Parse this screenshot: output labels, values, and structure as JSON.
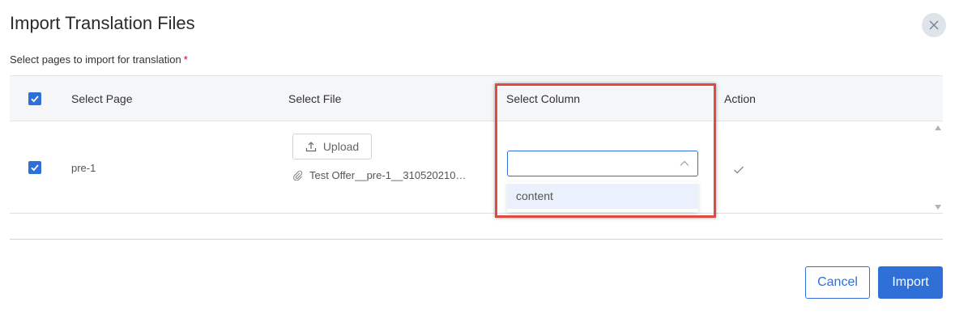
{
  "dialog": {
    "title": "Import Translation Files",
    "subtitle": "Select pages to import for translation",
    "required_marker": "*"
  },
  "table": {
    "headers": {
      "select_page": "Select Page",
      "select_file": "Select File",
      "select_column": "Select Column",
      "action": "Action"
    },
    "rows": [
      {
        "checked": true,
        "page": "pre-1",
        "upload_label": "Upload",
        "file_name": "Test Offer__pre-1__310520210…",
        "column_value": "",
        "column_options": [
          "content"
        ]
      }
    ]
  },
  "footer": {
    "cancel_label": "Cancel",
    "import_label": "Import"
  },
  "colors": {
    "accent": "#2f6fd8",
    "highlight": "#e04a3f",
    "header_bg": "#f5f6f8"
  }
}
